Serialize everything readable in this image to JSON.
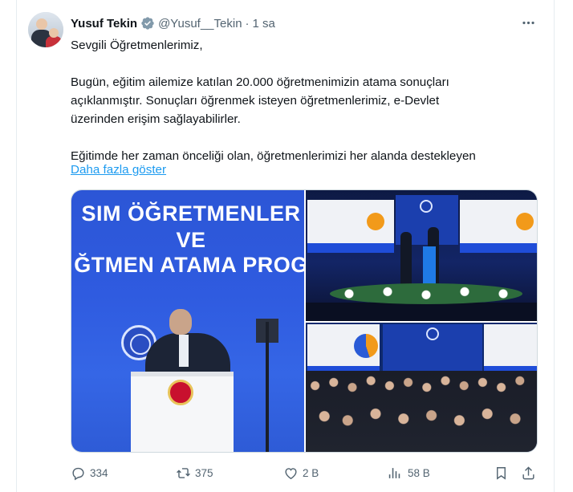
{
  "author": {
    "name": "Yusuf Tekin",
    "handle": "@Yusuf__Tekin",
    "separator": "·",
    "time": "1 sa"
  },
  "body": {
    "line1": "Sevgili Öğretmenlerimiz,",
    "line2": "Bugün, eğitim ailemize katılan 20.000 öğretmenimizin atama sonuçları",
    "line3": "açıklanmıştır. Sonuçları öğrenmek isteyen öğretmenlerimiz, e-Devlet",
    "line4": "üzerinden erişim sağlayabilirler.",
    "line5": "Eğitimde her zaman önceliği olan, öğretmenlerimizi her alanda destekleyen",
    "show_more": "Daha fazla göster"
  },
  "media": {
    "image1": {
      "banner_line1": "SIM ÖĞRETMENLER",
      "banner_line2": "VE",
      "banner_line3": "ĞTMEN ATAMA PROG"
    }
  },
  "actions": {
    "replies": "334",
    "reposts": "375",
    "likes": "2 B",
    "views": "58 B"
  },
  "colors": {
    "accent": "#1d9bf0",
    "secondary_text": "#536471",
    "border": "#cfd9de"
  },
  "icons": [
    "verified-badge-icon",
    "more-icon",
    "reply-icon",
    "repost-icon",
    "like-icon",
    "views-icon",
    "bookmark-icon",
    "share-icon"
  ]
}
